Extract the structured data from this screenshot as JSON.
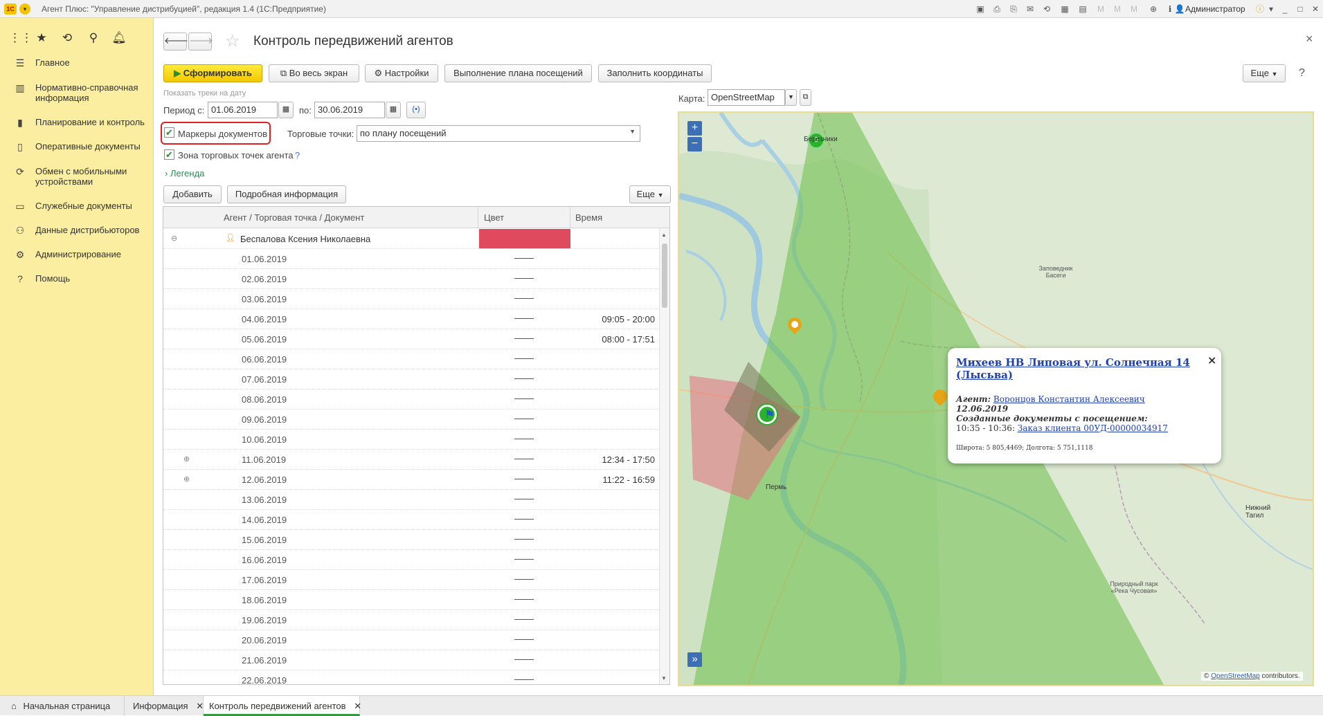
{
  "window": {
    "title": "Агент Плюс: \"Управление дистрибуцией\", редакция 1.4  (1С:Предприятие)",
    "user": "Администратор",
    "logo": "1С"
  },
  "sidebar": {
    "items": [
      {
        "icon": "menu-icon",
        "label": "Главное"
      },
      {
        "icon": "book-icon",
        "label": "Нормативно-справочная информация"
      },
      {
        "icon": "chart-icon",
        "label": "Планирование и контроль"
      },
      {
        "icon": "document-icon",
        "label": "Оперативные документы"
      },
      {
        "icon": "sync-icon",
        "label": "Обмен с мобильными устройствами"
      },
      {
        "icon": "folder-icon",
        "label": "Служебные документы"
      },
      {
        "icon": "people-icon",
        "label": "Данные дистрибьюторов"
      },
      {
        "icon": "gear-icon",
        "label": "Администрирование"
      },
      {
        "icon": "question-icon",
        "label": "Помощь"
      }
    ]
  },
  "page": {
    "title": "Контроль передвижений агентов",
    "close": "×"
  },
  "toolbar": {
    "generate": "Сформировать",
    "fullscreen": "Во весь экран",
    "settings": "Настройки",
    "plan": "Выполнение плана посещений",
    "fill_coords": "Заполнить координаты",
    "more": "Еще"
  },
  "filters": {
    "show_tracks_label": "Показать треки на дату",
    "period_from_label": "Период с:",
    "period_from": "01.06.2019",
    "period_to_label": "по:",
    "period_to": "30.06.2019",
    "doc_markers_label": "Маркеры документов",
    "doc_markers_checked": true,
    "trade_points_label": "Торговые точки:",
    "trade_points_value": "по плану посещений",
    "agent_zone_label": "Зона торговых точек агента",
    "agent_zone_checked": true,
    "help": "?",
    "legend": "Легенда"
  },
  "table_toolbar": {
    "add": "Добавить",
    "details": "Подробная информация",
    "more": "Еще"
  },
  "table": {
    "columns": [
      "Агент / Торговая точка / Документ",
      "Цвет",
      "Время"
    ],
    "agent": {
      "name": "Беспалова Ксения Николаевна",
      "color": "#e04a5f"
    },
    "rows": [
      {
        "date": "01.06.2019",
        "time": ""
      },
      {
        "date": "02.06.2019",
        "time": ""
      },
      {
        "date": "03.06.2019",
        "time": ""
      },
      {
        "date": "04.06.2019",
        "time": "09:05 - 20:00"
      },
      {
        "date": "05.06.2019",
        "time": "08:00 - 17:51"
      },
      {
        "date": "06.06.2019",
        "time": ""
      },
      {
        "date": "07.06.2019",
        "time": ""
      },
      {
        "date": "08.06.2019",
        "time": ""
      },
      {
        "date": "09.06.2019",
        "time": ""
      },
      {
        "date": "10.06.2019",
        "time": ""
      },
      {
        "date": "11.06.2019",
        "time": "12:34 - 17:50",
        "expandable": true
      },
      {
        "date": "12.06.2019",
        "time": "11:22 - 16:59",
        "expandable": true
      },
      {
        "date": "13.06.2019",
        "time": ""
      },
      {
        "date": "14.06.2019",
        "time": ""
      },
      {
        "date": "15.06.2019",
        "time": ""
      },
      {
        "date": "16.06.2019",
        "time": ""
      },
      {
        "date": "17.06.2019",
        "time": ""
      },
      {
        "date": "18.06.2019",
        "time": ""
      },
      {
        "date": "19.06.2019",
        "time": ""
      },
      {
        "date": "20.06.2019",
        "time": ""
      },
      {
        "date": "21.06.2019",
        "time": ""
      },
      {
        "date": "22.06.2019",
        "time": ""
      }
    ]
  },
  "map": {
    "provider_label": "Карта:",
    "provider": "OpenStreetMap",
    "zoom_in": "+",
    "zoom_out": "−",
    "expand": "»",
    "cluster_count": "5",
    "place_labels": [
      "Березники",
      "Заповедник Басеги",
      "Пермь",
      "Нижний Тагил",
      "Природный парк «Река Чусовая»"
    ],
    "attribution_prefix": "©",
    "attribution_link": "OpenStreetMap",
    "attribution_suffix": "contributors."
  },
  "popup": {
    "title": "Михеев НВ Липовая ул. Солнечная 14 (Лысьва)",
    "agent_label": "Агент:",
    "agent_name": "Воронцов Константин Алексеевич",
    "date": "12.06.2019",
    "docs_label": "Созданные документы с посещением:",
    "doc_time": "10:35 - 10:36:",
    "doc_link": "Заказ клиента 00УД-00000034917",
    "coords": "Широта: 5 805,4469; Долгота: 5 751,1118",
    "close": "×"
  },
  "tabs": [
    {
      "label": "Начальная страница"
    },
    {
      "label": "Информация"
    },
    {
      "label": "Контроль передвижений агентов"
    }
  ],
  "colors": {
    "sidebar_bg": "#fbeea0",
    "primary_button": "#f4c800",
    "agent_color": "#e04a5f",
    "zone_green": "#6cc04a",
    "highlight_border": "#e02020"
  }
}
